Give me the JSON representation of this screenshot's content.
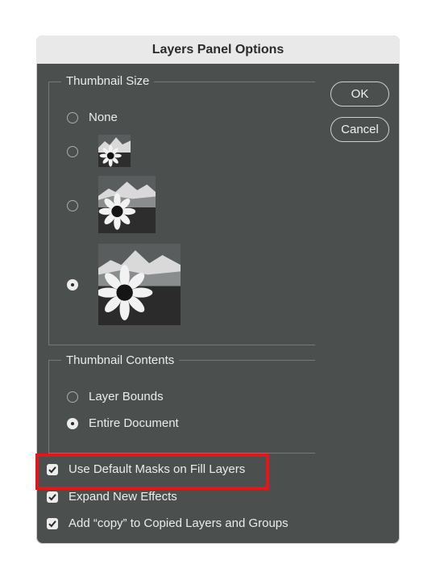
{
  "dialog": {
    "title": "Layers Panel Options",
    "ok_label": "OK",
    "cancel_label": "Cancel"
  },
  "thumbnail_size": {
    "title": "Thumbnail Size",
    "options": [
      {
        "label": "None",
        "selected": false
      },
      {
        "label": "",
        "selected": false,
        "thumbnail": "small"
      },
      {
        "label": "",
        "selected": false,
        "thumbnail": "medium"
      },
      {
        "label": "",
        "selected": true,
        "thumbnail": "large"
      }
    ]
  },
  "thumbnail_contents": {
    "title": "Thumbnail Contents",
    "options": [
      {
        "label": "Layer Bounds",
        "selected": false
      },
      {
        "label": "Entire Document",
        "selected": true
      }
    ]
  },
  "checkboxes": [
    {
      "label": "Use Default Masks on Fill Layers",
      "checked": true
    },
    {
      "label": "Expand New Effects",
      "checked": true
    },
    {
      "label": "Add “copy” to Copied Layers and Groups",
      "checked": true
    }
  ],
  "colors": {
    "dialog_bg": "#4b4f4d",
    "titlebar_bg": "#e9e9e9",
    "highlight": "#e8141c"
  }
}
